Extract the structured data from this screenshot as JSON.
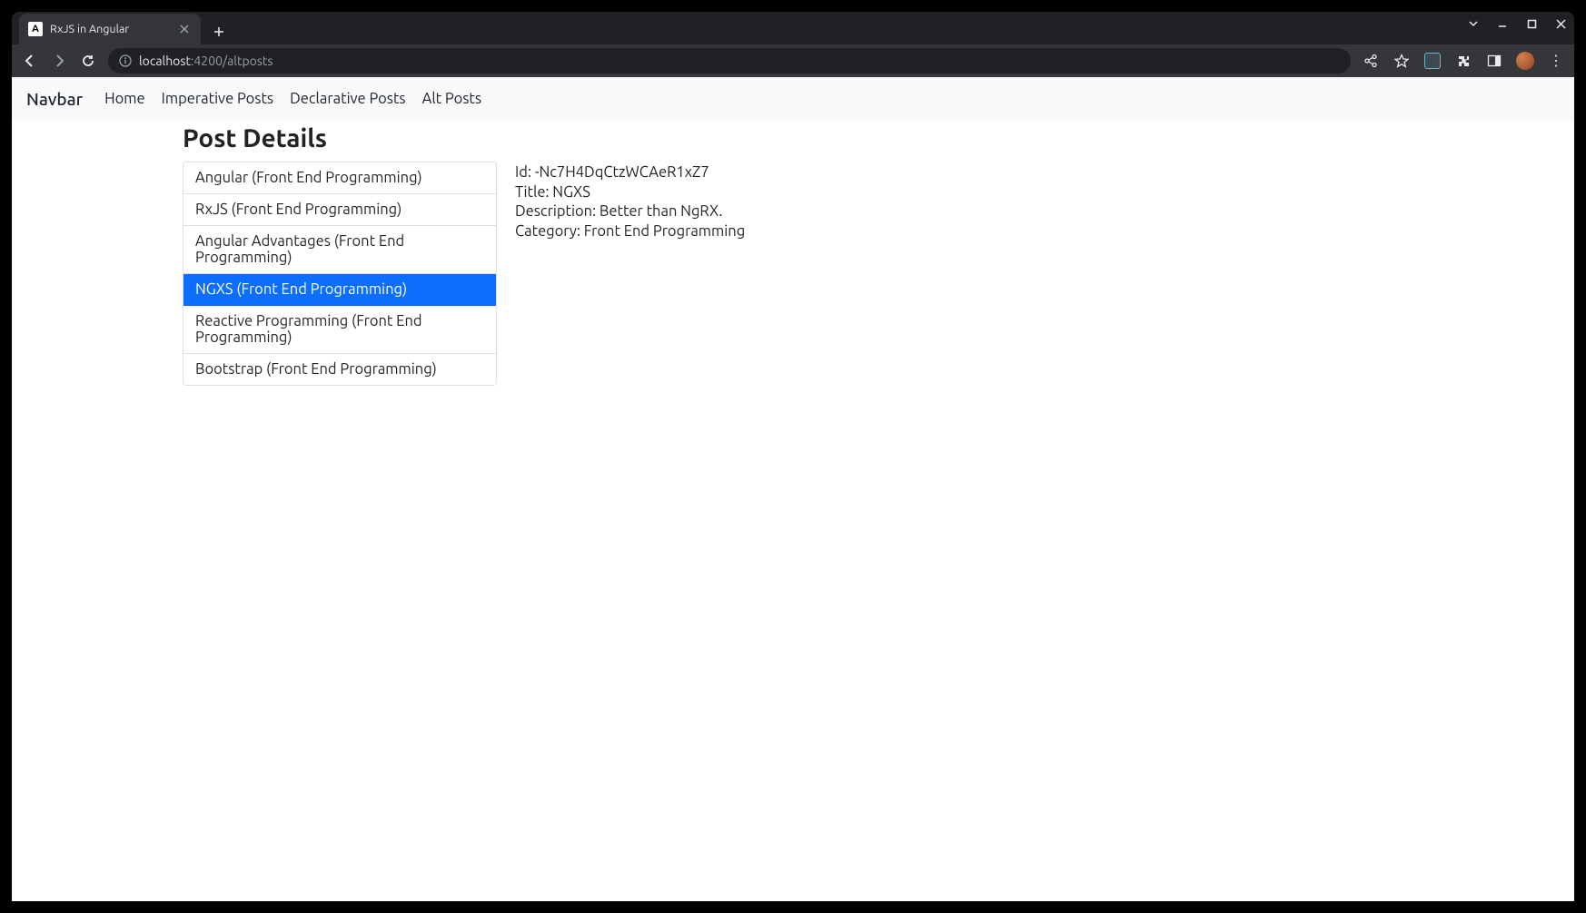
{
  "browser": {
    "tab_title": "RxJS in Angular",
    "tab_favicon_letter": "A",
    "url_host": "localhost",
    "url_rest": ":4200/altposts"
  },
  "navbar": {
    "brand": "Navbar",
    "links": [
      {
        "label": "Home"
      },
      {
        "label": "Imperative Posts"
      },
      {
        "label": "Declarative Posts"
      },
      {
        "label": "Alt Posts"
      }
    ]
  },
  "page": {
    "heading": "Post Details",
    "posts": [
      {
        "label": "Angular (Front End Programming)",
        "active": false
      },
      {
        "label": "RxJS (Front End Programming)",
        "active": false
      },
      {
        "label": "Angular Advantages (Front End Programming)",
        "active": false
      },
      {
        "label": "NGXS (Front End Programming)",
        "active": true
      },
      {
        "label": "Reactive Programming (Front End Programming)",
        "active": false
      },
      {
        "label": "Bootstrap (Front End Programming)",
        "active": false
      }
    ],
    "detail": {
      "id_line": "Id: -Nc7H4DqCtzWCAeR1xZ7",
      "title_line": "Title: NGXS",
      "description_line": "Description: Better than NgRX.",
      "category_line": "Category: Front End Programming"
    }
  }
}
